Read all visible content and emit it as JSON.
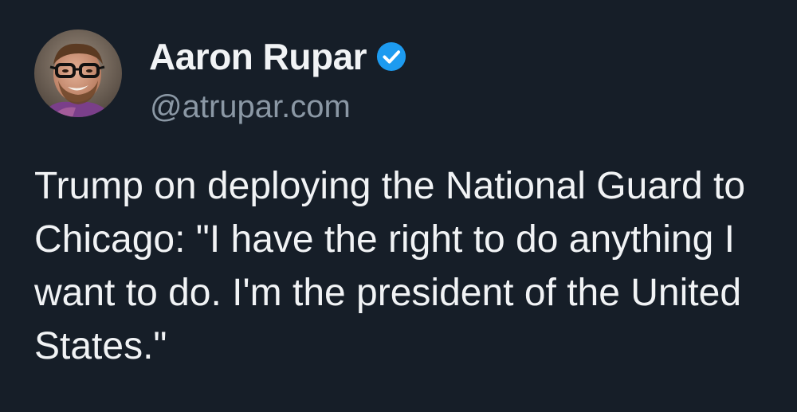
{
  "author": {
    "display_name": "Aaron Rupar",
    "handle": "@atrupar.com",
    "verified": true,
    "badge_color": "#1d9bf0",
    "avatar_icon": "profile-photo"
  },
  "post": {
    "text": "Trump on deploying the National Guard to Chicago: \"I have the right to do anything I want to do. I'm the president of the United States.\""
  },
  "colors": {
    "background": "#161e28",
    "text": "#f1f3f5",
    "muted": "#8b98a5"
  }
}
